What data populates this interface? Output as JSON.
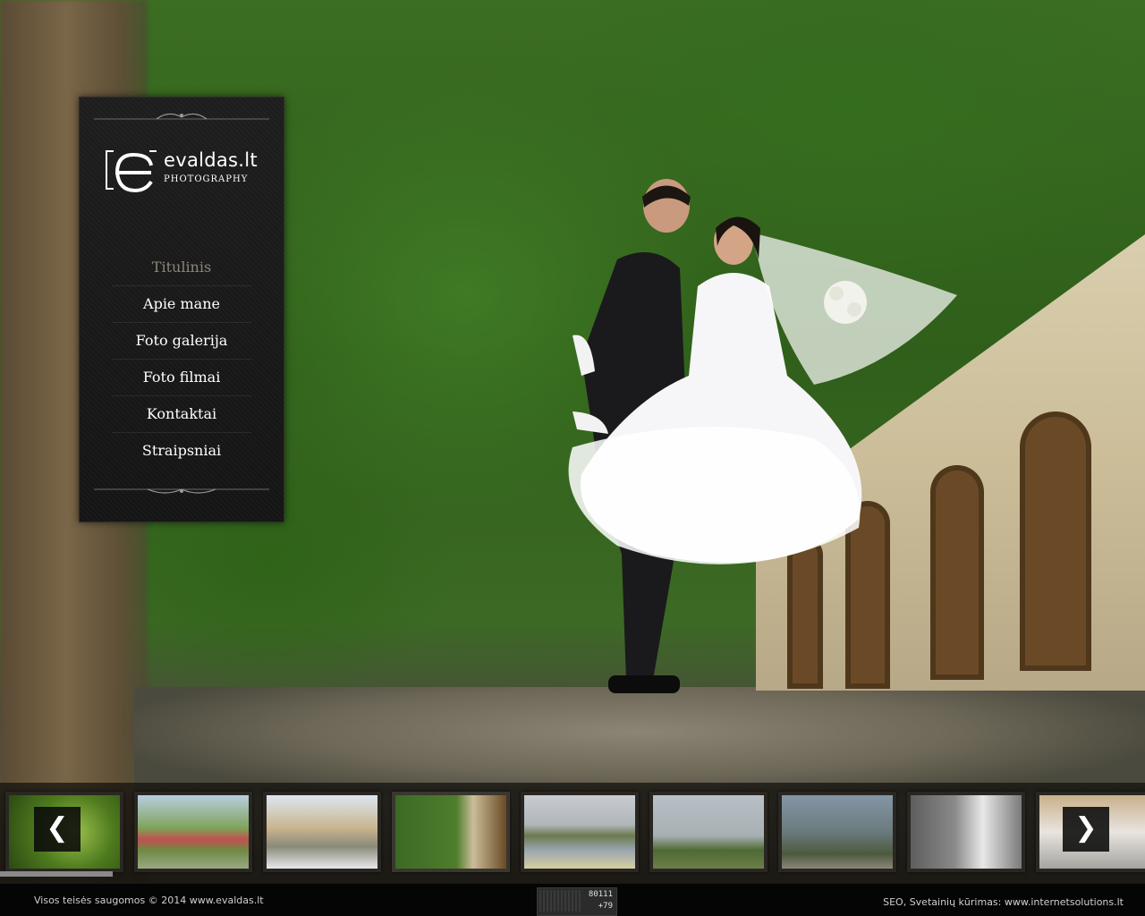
{
  "brand": {
    "logo_text": "evaldas.lt",
    "logo_sub": "PHOTOGRAPHY"
  },
  "nav": {
    "items": [
      {
        "label": "Titulinis",
        "active": true
      },
      {
        "label": "Apie mane",
        "active": false
      },
      {
        "label": "Foto galerija",
        "active": false
      },
      {
        "label": "Foto filmai",
        "active": false
      },
      {
        "label": "Kontaktai",
        "active": false
      },
      {
        "label": "Straipsniai",
        "active": false
      }
    ]
  },
  "gallery": {
    "prev_icon": "chevron-left-icon",
    "next_icon": "chevron-right-icon",
    "thumbnails": [
      "thumb-1",
      "thumb-2",
      "thumb-3",
      "thumb-4",
      "thumb-5",
      "thumb-6",
      "thumb-7",
      "thumb-8",
      "thumb-9"
    ],
    "active_index": 3
  },
  "footer": {
    "copyright": "Visos teisės saugomos © 2014 www.evaldas.lt",
    "credits": "SEO, Svetainių kūrimas: www.internetsolutions.lt",
    "counter_total": "80111",
    "counter_today": "+79"
  },
  "colors": {
    "active_menu": "#8c8678",
    "menu_bg": "#1a1a1a",
    "footer_bg": "#050505"
  }
}
